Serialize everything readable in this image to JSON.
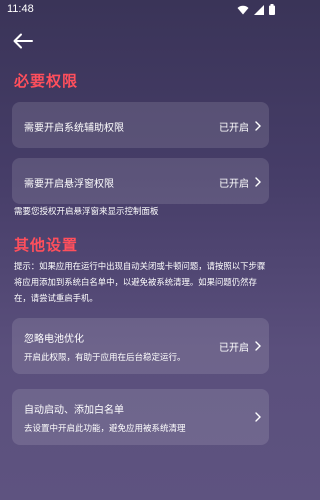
{
  "status_bar": {
    "time": "11:48"
  },
  "section_required": {
    "title": "必要权限"
  },
  "accessibility_card": {
    "title": "需要开启系统辅助权限",
    "status": "已开启"
  },
  "overlay_card": {
    "title": "需要开启悬浮窗权限",
    "status": "已开启"
  },
  "overlay_note": "需要您授权开启悬浮窗来显示控制面板",
  "section_other": {
    "title": "其他设置"
  },
  "hint": {
    "text": "提示：如果应用在运行中出现自动关闭或卡顿问题，请按照以下步骤将应用添加到系统白名单中，以避免被系统清理。如果问题仍然存在，请尝试重启手机。"
  },
  "battery_card": {
    "title": "忽略电池优化",
    "subtitle": "开启此权限，有助于应用在后台稳定运行。",
    "status": "已开启"
  },
  "autostart_card": {
    "title": "自动启动、添加白名单",
    "subtitle": "去设置中开启此功能，避免应用被系统清理"
  },
  "colors": {
    "accent": "#ff4f5c",
    "card_bg": "rgba(255,255,255,0.12)"
  },
  "icons": {
    "back": "arrow-left-icon",
    "chevron": "chevron-right-icon",
    "wifi": "wifi-icon",
    "signal": "signal-icon",
    "battery": "battery-icon"
  }
}
